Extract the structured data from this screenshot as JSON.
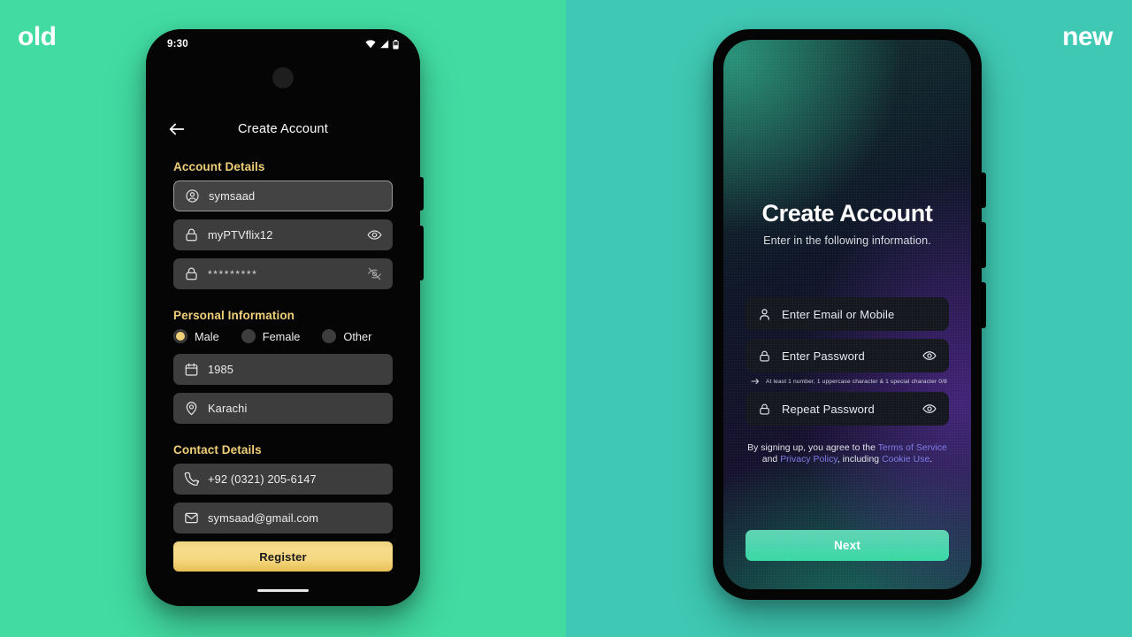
{
  "labels": {
    "old": "old",
    "new": "new"
  },
  "colors": {
    "bg_left": "#42DCA3",
    "bg_right": "#3FC9B4",
    "accent_gold": "#F0CF79",
    "accent_teal": "#4ED4AE",
    "link_purple": "#7E7CE8"
  },
  "old_phone": {
    "status_bar": {
      "time": "9:30",
      "icons": [
        "wifi-icon",
        "signal-icon",
        "battery-icon"
      ]
    },
    "app_bar": {
      "back_icon": "arrow-left-icon",
      "title": "Create Account"
    },
    "sections": [
      {
        "heading": "Account Details",
        "fields": [
          {
            "icon": "account-circle-icon",
            "value": "symsaad",
            "trailing": null,
            "focused": true
          },
          {
            "icon": "lock-icon",
            "value": "myPTVflix12",
            "trailing": "eye-icon",
            "focused": false
          },
          {
            "icon": "lock-icon",
            "value": "*********",
            "trailing": "eye-off-icon",
            "focused": false,
            "masked": true
          }
        ]
      },
      {
        "heading": "Personal Information",
        "radios": [
          {
            "label": "Male",
            "selected": true
          },
          {
            "label": "Female",
            "selected": false
          },
          {
            "label": "Other",
            "selected": false
          }
        ],
        "fields": [
          {
            "icon": "calendar-icon",
            "value": "1985",
            "trailing": null,
            "focused": false
          },
          {
            "icon": "location-pin-icon",
            "value": "Karachi",
            "trailing": null,
            "focused": false
          }
        ]
      },
      {
        "heading": "Contact Details",
        "fields": [
          {
            "icon": "phone-icon",
            "value": "+92 (0321) 205-6147",
            "trailing": null,
            "focused": false
          },
          {
            "icon": "mail-icon",
            "value": "symsaad@gmail.com",
            "trailing": null,
            "focused": false
          }
        ]
      }
    ],
    "submit_label": "Register"
  },
  "new_phone": {
    "title": "Create Account",
    "subtitle": "Enter in the following information.",
    "fields": [
      {
        "icon": "person-icon",
        "placeholder": "Enter Email or Mobile",
        "trailing": null
      },
      {
        "icon": "lock-icon",
        "placeholder": "Enter Password",
        "trailing": "eye-icon"
      },
      {
        "icon": "lock-icon",
        "placeholder": "Repeat Password",
        "trailing": "eye-icon"
      }
    ],
    "password_hint": {
      "icon": "arrow-right-icon",
      "text": "At least 1 number, 1 uppercase character & 1 special character 0/8"
    },
    "legal": {
      "part1": "By signing up, you agree to the ",
      "link1": "Terms of Service",
      "part2": " and ",
      "link2": "Privacy Policy",
      "part3": ", including ",
      "link3": "Cookie Use",
      "part4": "."
    },
    "submit_label": "Next"
  }
}
